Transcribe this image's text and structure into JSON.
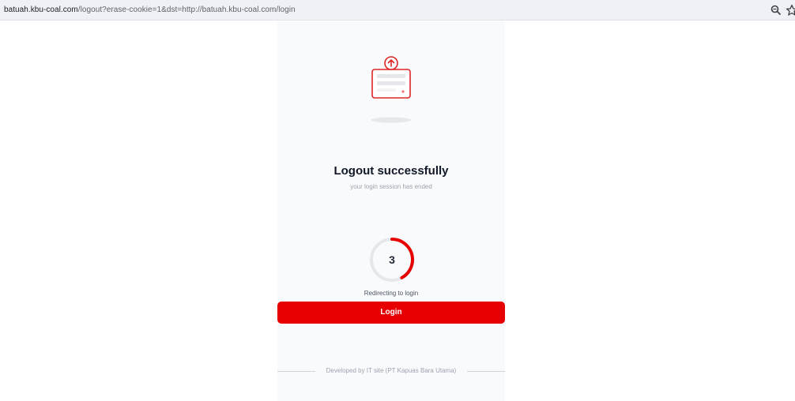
{
  "browser": {
    "url_host": "batuah.kbu-coal.com",
    "url_rest": "/logout?erase-cookie=1&dst=http://batuah.kbu-coal.com/login"
  },
  "page": {
    "title": "Logout successfully",
    "subtitle": "your login session has ended",
    "countdown": "3",
    "countdown_progress": 0.42,
    "redirect_text": "Redirecting to login",
    "login_label": "Login",
    "footer_text": "Developed by IT site (PT Kapuas Bara Utama)",
    "accent_color": "#e60000"
  }
}
